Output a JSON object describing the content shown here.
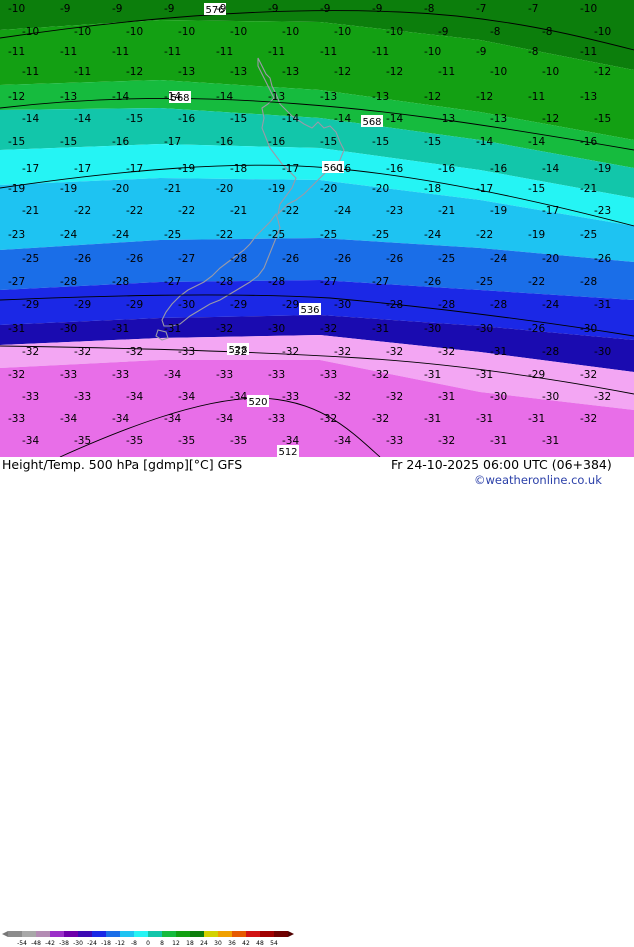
{
  "map": {
    "bands": [
      {
        "name": "band-dark-green",
        "color": "#0c7e0c"
      },
      {
        "name": "band-green",
        "color": "#13a013"
      },
      {
        "name": "band-light-green",
        "color": "#16bb3e"
      },
      {
        "name": "band-teal",
        "color": "#12c6aa"
      },
      {
        "name": "band-cyan",
        "color": "#25f4f4"
      },
      {
        "name": "band-sky",
        "color": "#1ec3f2"
      },
      {
        "name": "band-blue",
        "color": "#1a6ee8"
      },
      {
        "name": "band-royal",
        "color": "#1b28e6"
      },
      {
        "name": "band-navy",
        "color": "#1a0bb0"
      },
      {
        "name": "band-pink",
        "color": "#f3a6f3"
      },
      {
        "name": "band-magenta",
        "color": "#e86ee8"
      }
    ],
    "contour_color": "#000000",
    "height_labels": [
      "576",
      "568",
      "568",
      "560",
      "536",
      "528",
      "520",
      "512"
    ],
    "temp_labels": [
      "-10",
      "-9",
      "-9",
      "-9",
      "-9",
      "-9",
      "-9",
      "-9",
      "-8",
      "-7",
      "-7",
      "-10",
      "-10",
      "-10",
      "-10",
      "-10",
      "-10",
      "-10",
      "-10",
      "-10",
      "-9",
      "-8",
      "-8",
      "-10",
      "-11",
      "-11",
      "-11",
      "-11",
      "-11",
      "-11",
      "-11",
      "-11",
      "-10",
      "-9",
      "-8",
      "-11",
      "-11",
      "-11",
      "-12",
      "-13",
      "-13",
      "-13",
      "-12",
      "-12",
      "-11",
      "-10",
      "-10",
      "-12",
      "-12",
      "-13",
      "-14",
      "-14",
      "-14",
      "-13",
      "-13",
      "-13",
      "-12",
      "-12",
      "-11",
      "-13",
      "-14",
      "-14",
      "-15",
      "-16",
      "-15",
      "-14",
      "-14",
      "-14",
      "-13",
      "-13",
      "-12",
      "-15",
      "-15",
      "-15",
      "-16",
      "-17",
      "-16",
      "-16",
      "-15",
      "-15",
      "-15",
      "-14",
      "-14",
      "-16",
      "-17",
      "-17",
      "-17",
      "-19",
      "-18",
      "-17",
      "-16",
      "-16",
      "-16",
      "-16",
      "-14",
      "-19",
      "-19",
      "-19",
      "-20",
      "-21",
      "-20",
      "-19",
      "-20",
      "-20",
      "-18",
      "-17",
      "-15",
      "-21",
      "-21",
      "-22",
      "-22",
      "-22",
      "-21",
      "-22",
      "-24",
      "-23",
      "-21",
      "-19",
      "-17",
      "-23",
      "-23",
      "-24",
      "-24",
      "-25",
      "-22",
      "-25",
      "-25",
      "-25",
      "-24",
      "-22",
      "-19",
      "-25",
      "-25",
      "-26",
      "-26",
      "-27",
      "-28",
      "-26",
      "-26",
      "-26",
      "-25",
      "-24",
      "-20",
      "-26",
      "-27",
      "-28",
      "-28",
      "-27",
      "-28",
      "-28",
      "-27",
      "-27",
      "-26",
      "-25",
      "-22",
      "-28",
      "-29",
      "-29",
      "-29",
      "-30",
      "-29",
      "-29",
      "-30",
      "-28",
      "-28",
      "-28",
      "-24",
      "-31",
      "-31",
      "-30",
      "-31",
      "-31",
      "-32",
      "-30",
      "-32",
      "-31",
      "-30",
      "-30",
      "-26",
      "-30",
      "-32",
      "-32",
      "-32",
      "-33",
      "-32",
      "-32",
      "-32",
      "-32",
      "-32",
      "-31",
      "-28",
      "-30",
      "-32",
      "-33",
      "-33",
      "-34",
      "-33",
      "-33",
      "-33",
      "-32",
      "-31",
      "-31",
      "-29",
      "-32",
      "-33",
      "-33",
      "-34",
      "-34",
      "-34",
      "-33",
      "-32",
      "-32",
      "-31",
      "-30",
      "-30",
      "-32",
      "-33",
      "-34",
      "-34",
      "-34",
      "-34",
      "-33",
      "-32",
      "-32",
      "-31",
      "-31",
      "-31",
      "-32",
      "-34",
      "-35",
      "-35",
      "-35",
      "-35",
      "-34",
      "-34",
      "-33",
      "-32",
      "-31",
      "-31"
    ]
  },
  "footer": {
    "product": "Height/Temp. 500 hPa [gdmp][°C] GFS",
    "validity": "Fr 24-10-2025 06:00 UTC (06+384)",
    "credit": "©weatheronline.co.uk",
    "colorbar": {
      "ticks": [
        "-54",
        "-48",
        "-42",
        "-38",
        "-30",
        "-24",
        "-18",
        "-12",
        "-8",
        "0",
        "8",
        "12",
        "18",
        "24",
        "30",
        "36",
        "42",
        "48",
        "54"
      ],
      "colors": [
        "#8c8c8c",
        "#a8a8a8",
        "#b48cb4",
        "#9b30c8",
        "#6e00aa",
        "#3c0ab4",
        "#1a28e6",
        "#1a6ee8",
        "#1ec3f2",
        "#25f4f4",
        "#12c6aa",
        "#16bb3e",
        "#13a013",
        "#0c7e0c",
        "#d2d200",
        "#f0a000",
        "#e65a00",
        "#d21414",
        "#a00000",
        "#6e0000"
      ]
    }
  }
}
